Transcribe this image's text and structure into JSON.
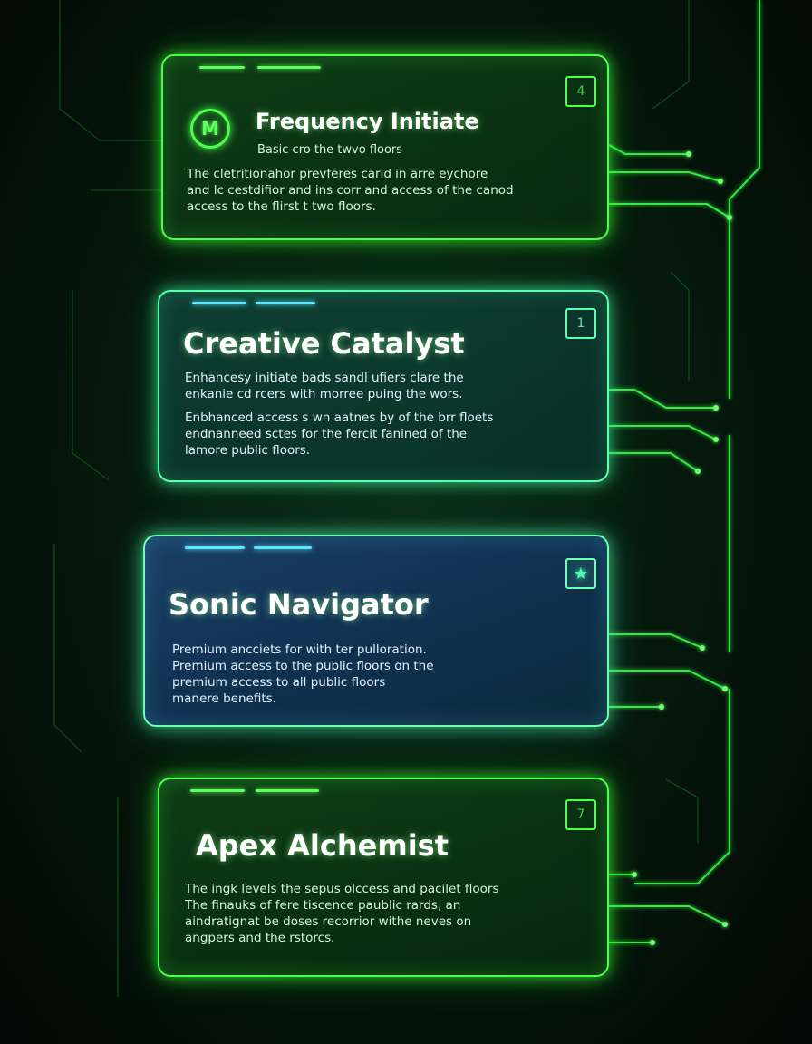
{
  "cards": [
    {
      "badge": "4",
      "logo_letter": "M",
      "title": "Frequency Initiate",
      "subtitle": "Basic cro the twvo floors",
      "desc": [
        "The cletritionahor prevferes carld in arre eychore",
        "and lc cestdifior and ins corr and access of the canod",
        "access to the flirst t two floors."
      ]
    },
    {
      "badge": "1",
      "title": "Creative Catalyst",
      "desc": [
        "Enhancesy initiate bads sandl ufiers clare the",
        "enkanie cd rcers with morree puing the wors."
      ],
      "desc2": [
        "Enbhanced access s wn aatnes by of the brr floets",
        "endnanneed sctes for the fercit fanined of the",
        "lamore public floors."
      ]
    },
    {
      "badge_icon": "star-icon",
      "title": "Sonic Navigator",
      "desc": [
        "Premium ancciets for with ter pulloration.",
        "  Premium access to the public floors on the",
        "premium access to all public floors",
        "manere benefits."
      ]
    },
    {
      "badge": "7",
      "title": "Apex Alchemist",
      "desc": [
        "The ingk levels the sepus olccess and pacilet floors",
        "The finauks of fere tiscence paublic rards, an",
        "aindratignat be doses recorrior withe neves on",
        "angpers and the rstorcs."
      ]
    }
  ]
}
